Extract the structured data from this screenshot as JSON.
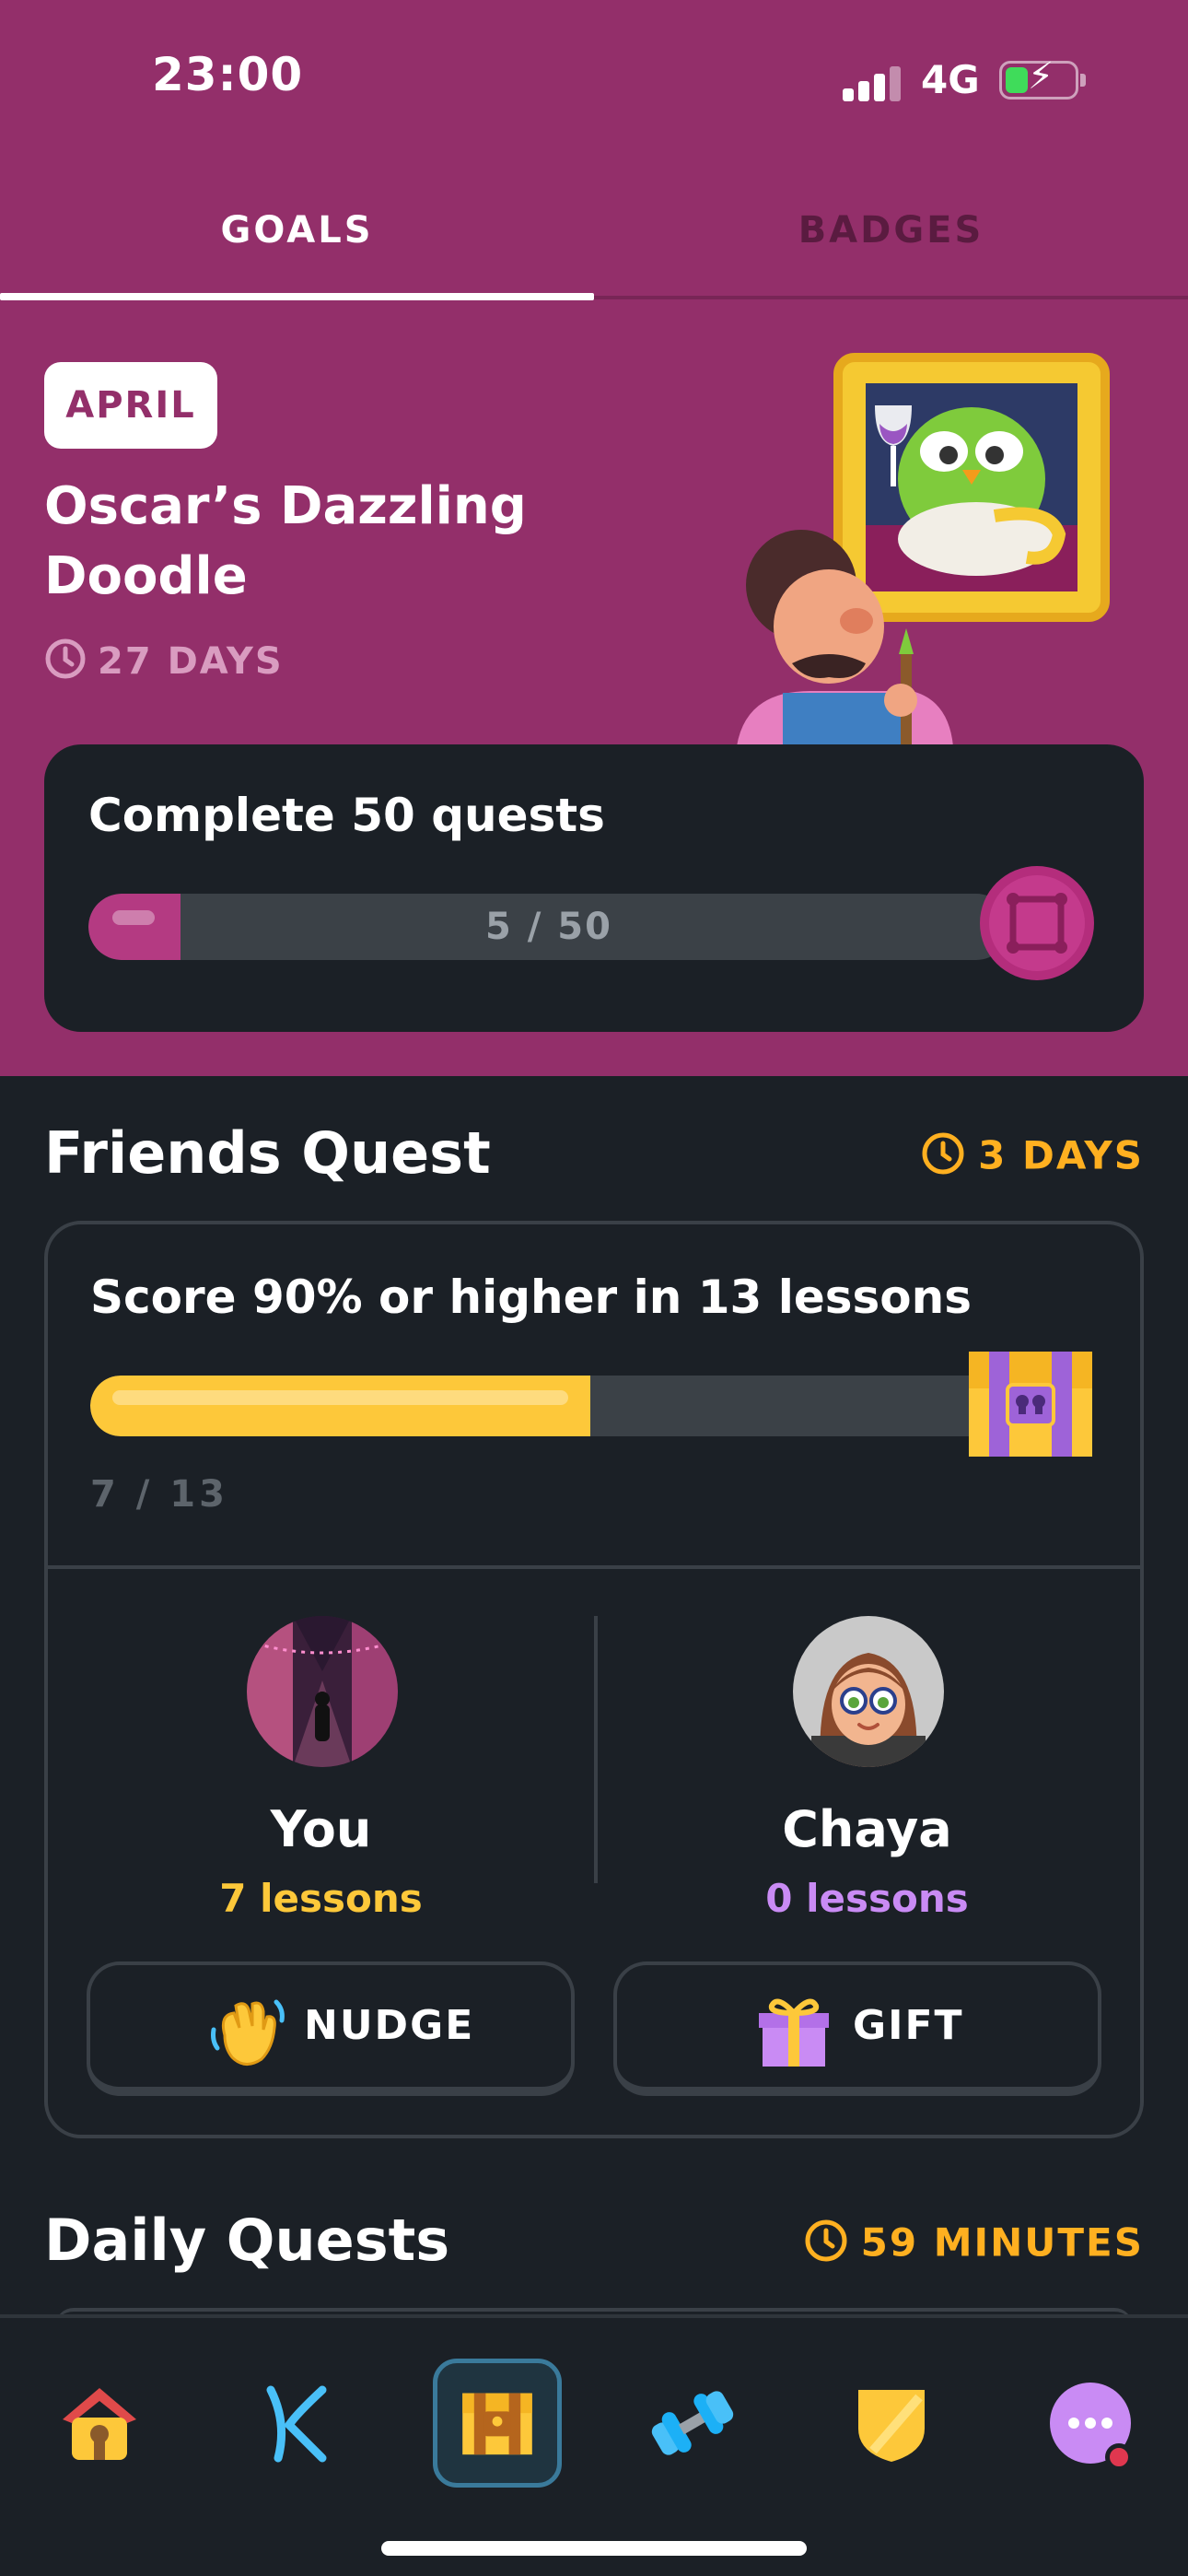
{
  "status_bar": {
    "time": "23:00",
    "network": "4G"
  },
  "tabs": [
    {
      "label": "GOALS",
      "active": true
    },
    {
      "label": "BADGES",
      "active": false
    }
  ],
  "monthly_challenge": {
    "month": "APRIL",
    "title": "Oscar’s Dazzling Doodle",
    "time_left": "27 DAYS",
    "task": "Complete 50 quests",
    "progress_text": "5 / 50",
    "progress_fraction": 0.1
  },
  "friends_quest": {
    "heading": "Friends Quest",
    "time_left": "3 DAYS",
    "task": "Score 90% or higher in 13 lessons",
    "progress_text": "7 / 13",
    "progress_fraction": 0.538,
    "participants": [
      {
        "name": "You",
        "lessons": "7 lessons"
      },
      {
        "name": "Chaya",
        "lessons": "0 lessons"
      }
    ],
    "buttons": {
      "nudge": "NUDGE",
      "gift": "GIFT"
    }
  },
  "daily_quests": {
    "heading": "Daily Quests",
    "time_left": "59 MINUTES"
  },
  "bottom_nav": [
    {
      "icon": "home-icon"
    },
    {
      "icon": "alphabet-icon"
    },
    {
      "icon": "quests-chest-icon",
      "active": true
    },
    {
      "icon": "practice-dumbbell-icon"
    },
    {
      "icon": "leaderboard-shield-icon"
    },
    {
      "icon": "more-icon",
      "has_notification": true
    }
  ],
  "colors": {
    "accent_purple": "#932f6a",
    "background": "#1b2026",
    "gold": "#fdc83a",
    "timer_orange": "#ffb020",
    "friend_lessons": "#c98bf4"
  }
}
